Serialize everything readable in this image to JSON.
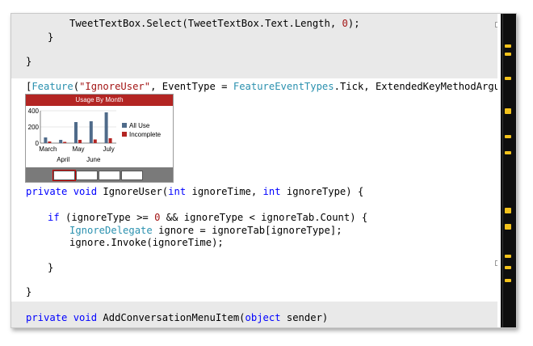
{
  "editor": {
    "lines": {
      "l1": [
        "TweetTextBox.Select(TweetTextBox.Text.Length, ",
        "0",
        ");"
      ],
      "l2": "}",
      "l3": "}",
      "attr": [
        "[",
        "Feature",
        "(",
        "\"IgnoreUser\"",
        ", EventType = ",
        "FeatureEventTypes",
        ".Tick, ExtendedKeyMethodArguments"
      ],
      "sig": [
        "private",
        " ",
        "void",
        " IgnoreUser(",
        "int",
        " ignoreTime, ",
        "int",
        " ignoreType) {"
      ],
      "if": [
        "if",
        " (ignoreType >= ",
        "0",
        " && ignoreType < ignoreTab.Count) {"
      ],
      "decl": [
        "IgnoreDelegate",
        " ignore = ignoreTab[ignoreType];"
      ],
      "invoke": "ignore.Invoke(ignoreTime);",
      "close1": "}",
      "close2": "}",
      "last": [
        "private",
        " ",
        "void",
        " AddConversationMenuItem(",
        "object",
        " sender)"
      ]
    }
  },
  "widget": {
    "title": "Usage By Month",
    "legend": [
      "All Use",
      "Incomplete"
    ],
    "colors": {
      "title_bg": "#b32523",
      "all_use": "#4f6b8a",
      "incomplete": "#b32523"
    }
  },
  "chart_data": {
    "type": "bar",
    "title": "Usage By Month",
    "categories": [
      "March",
      "April",
      "May",
      "June",
      "July"
    ],
    "series": [
      {
        "name": "All Use",
        "values": [
          70,
          40,
          260,
          270,
          380
        ]
      },
      {
        "name": "Incomplete",
        "values": [
          20,
          15,
          40,
          45,
          60
        ]
      }
    ],
    "y_ticks": [
      "0",
      "200",
      "400"
    ],
    "ylim": [
      0,
      400
    ],
    "grid": true,
    "legend": "right"
  },
  "minimap": {
    "icon": "overview-margin"
  }
}
